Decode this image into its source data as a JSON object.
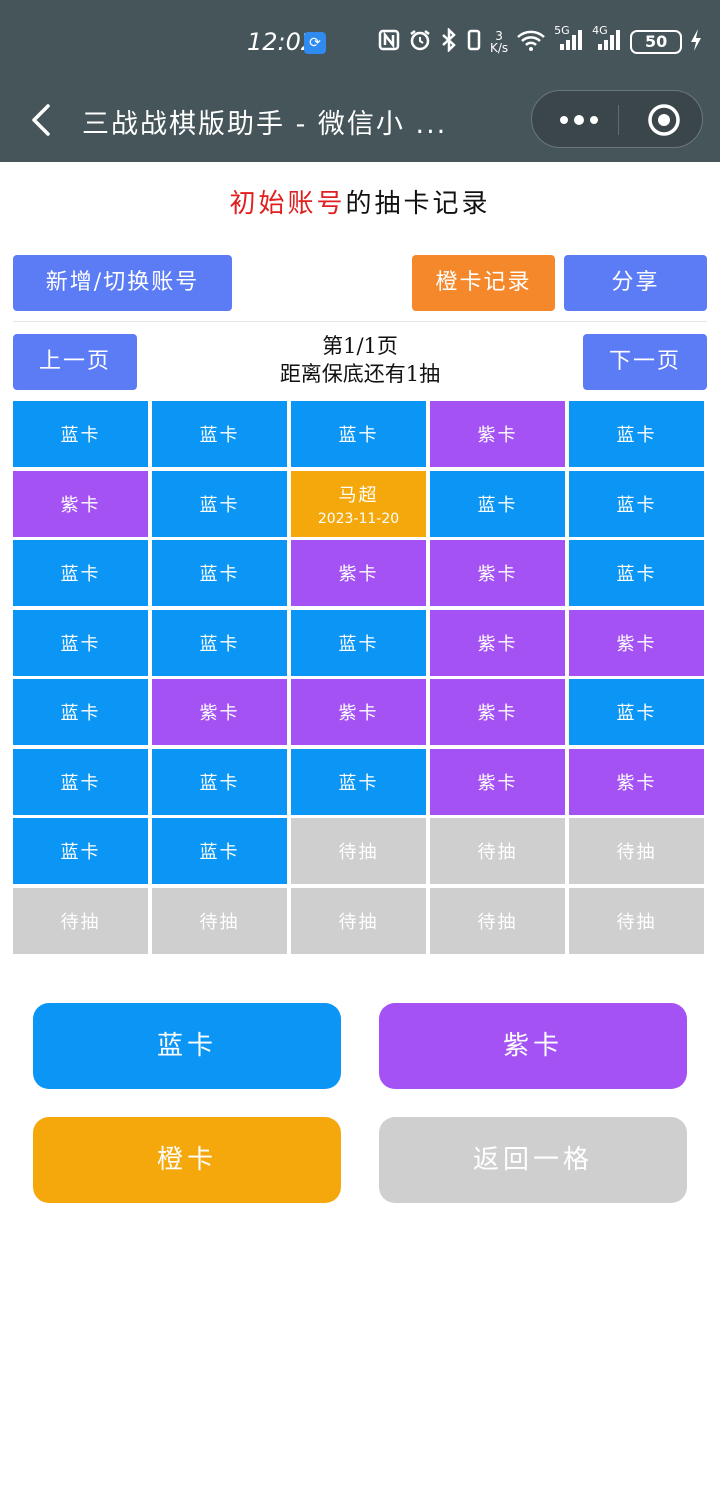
{
  "status_bar": {
    "time": "12:02",
    "speed_top": "3",
    "speed_unit": "K/s",
    "net_5g": "5G",
    "net_4g": "4G",
    "battery": "50"
  },
  "nav": {
    "title": "三战战棋版助手 - 微信小 ..."
  },
  "header": {
    "account_name": "初始账号",
    "title_suffix": "的抽卡记录"
  },
  "toolbar": {
    "switch_account": "新增/切换账号",
    "orange_records": "橙卡记录",
    "share": "分享"
  },
  "pager": {
    "prev": "上一页",
    "next": "下一页",
    "page_label": "第1/1页",
    "pity_label": "距离保底还有1抽"
  },
  "grid": [
    [
      {
        "type": "blue",
        "label": "蓝卡"
      },
      {
        "type": "blue",
        "label": "蓝卡"
      },
      {
        "type": "blue",
        "label": "蓝卡"
      },
      {
        "type": "purple",
        "label": "紫卡"
      },
      {
        "type": "blue",
        "label": "蓝卡"
      }
    ],
    [
      {
        "type": "purple",
        "label": "紫卡"
      },
      {
        "type": "blue",
        "label": "蓝卡"
      },
      {
        "type": "orange",
        "label": "马超",
        "date": "2023-11-20"
      },
      {
        "type": "blue",
        "label": "蓝卡"
      },
      {
        "type": "blue",
        "label": "蓝卡"
      }
    ],
    [
      {
        "type": "blue",
        "label": "蓝卡"
      },
      {
        "type": "blue",
        "label": "蓝卡"
      },
      {
        "type": "purple",
        "label": "紫卡"
      },
      {
        "type": "purple",
        "label": "紫卡"
      },
      {
        "type": "blue",
        "label": "蓝卡"
      }
    ],
    [
      {
        "type": "blue",
        "label": "蓝卡"
      },
      {
        "type": "blue",
        "label": "蓝卡"
      },
      {
        "type": "blue",
        "label": "蓝卡"
      },
      {
        "type": "purple",
        "label": "紫卡"
      },
      {
        "type": "purple",
        "label": "紫卡"
      }
    ],
    [
      {
        "type": "blue",
        "label": "蓝卡"
      },
      {
        "type": "purple",
        "label": "紫卡"
      },
      {
        "type": "purple",
        "label": "紫卡"
      },
      {
        "type": "purple",
        "label": "紫卡"
      },
      {
        "type": "blue",
        "label": "蓝卡"
      }
    ],
    [
      {
        "type": "blue",
        "label": "蓝卡"
      },
      {
        "type": "blue",
        "label": "蓝卡"
      },
      {
        "type": "blue",
        "label": "蓝卡"
      },
      {
        "type": "purple",
        "label": "紫卡"
      },
      {
        "type": "purple",
        "label": "紫卡"
      }
    ],
    [
      {
        "type": "blue",
        "label": "蓝卡"
      },
      {
        "type": "blue",
        "label": "蓝卡"
      },
      {
        "type": "grey",
        "label": "待抽"
      },
      {
        "type": "grey",
        "label": "待抽"
      },
      {
        "type": "grey",
        "label": "待抽"
      }
    ],
    [
      {
        "type": "grey",
        "label": "待抽"
      },
      {
        "type": "grey",
        "label": "待抽"
      },
      {
        "type": "grey",
        "label": "待抽"
      },
      {
        "type": "grey",
        "label": "待抽"
      },
      {
        "type": "grey",
        "label": "待抽"
      }
    ]
  ],
  "actions": {
    "blue": "蓝卡",
    "purple": "紫卡",
    "orange": "橙卡",
    "undo": "返回一格"
  },
  "colors": {
    "blue": "#0b96f5",
    "purple": "#a552f5",
    "orange": "#f5a80b",
    "grey": "#cfcfcf",
    "accent_button": "#5b7cf5",
    "orange_button": "#f5882b",
    "account_red": "#e02020",
    "bar_bg": "#46555a"
  },
  "icons": {
    "back": "chevron-left-icon",
    "more": "more-dots-icon",
    "close": "target-circle-icon",
    "sync": "sync-icon",
    "nfc": "nfc-icon",
    "alarm": "alarm-icon",
    "bluetooth": "bluetooth-icon",
    "vibrate": "vibrate-icon",
    "wifi": "wifi-icon",
    "signal": "signal-icon",
    "charging": "charging-icon"
  }
}
